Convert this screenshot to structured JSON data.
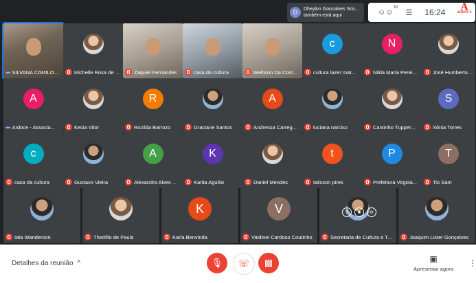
{
  "notification": {
    "text_line1": "Dheylon Goncalves Sco...",
    "text_line2": "também está aqui",
    "avatar_letter": "D"
  },
  "status": {
    "participants_count": "32",
    "time": "16:24",
    "logo_text": "A",
    "logo_sub": "ARDOCE"
  },
  "tiles_row1_video": [
    {
      "name": "SILVANA CAMILO...",
      "state": "speaking"
    },
    {
      "name": "Michelle Rosa de ...",
      "state": "muted"
    },
    {
      "name": "Zaquiel Fernandes",
      "state": "muted"
    },
    {
      "name": "casa da cultura",
      "state": "muted"
    },
    {
      "name": "Wellison Da Cost...",
      "state": "muted"
    }
  ],
  "tiles_row1_avatar": [
    {
      "letter": "c",
      "color": "#1a9be0",
      "name": "cultura lazer mat..."
    },
    {
      "letter": "N",
      "color": "#e91e63",
      "name": "Nilda Maria Perei..."
    },
    {
      "letter": "",
      "color": "photo",
      "name": "José Humberto F..."
    }
  ],
  "tiles_row2": [
    {
      "letter": "A",
      "color": "#e91e63",
      "name": "Ardoce - Associa...",
      "state": "speaking"
    },
    {
      "letter": "",
      "color": "photo",
      "name": "Kecia Vitor",
      "state": "muted"
    },
    {
      "letter": "R",
      "color": "#f57c00",
      "name": "Rozilda Barrozo",
      "state": "muted"
    },
    {
      "letter": "",
      "color": "photo2",
      "name": "Graciane Santos",
      "state": "muted"
    },
    {
      "letter": "A",
      "color": "#e64a19",
      "name": "Andressa Carreg...",
      "state": "muted"
    },
    {
      "letter": "",
      "color": "photo2",
      "name": "luciana narciso",
      "state": "muted"
    },
    {
      "letter": "",
      "color": "photo",
      "name": "Cantinho Tupper...",
      "state": "muted"
    },
    {
      "letter": "S",
      "color": "#5c6bc0",
      "name": "Sônia Torres",
      "state": "muted"
    }
  ],
  "tiles_row3": [
    {
      "letter": "c",
      "color": "#00acc1",
      "name": "casa da cultura",
      "state": "muted"
    },
    {
      "letter": "",
      "color": "photo2",
      "name": "Gustavo Vieira",
      "state": "muted"
    },
    {
      "letter": "A",
      "color": "#43a047",
      "name": "Alexandra Alves ...",
      "state": "muted"
    },
    {
      "letter": "K",
      "color": "#5e35b1",
      "name": "Karita Aguilar",
      "state": "muted"
    },
    {
      "letter": "",
      "color": "photo",
      "name": "Daniel Mendes",
      "state": "muted"
    },
    {
      "letter": "t",
      "color": "#f4511e",
      "name": "talisson pires",
      "state": "muted"
    },
    {
      "letter": "P",
      "color": "#1e88e5",
      "name": "Prefeitura Virgola...",
      "state": "muted"
    },
    {
      "letter": "T",
      "color": "#8d6e63",
      "name": "Tio Sam",
      "state": "muted"
    }
  ],
  "tiles_row4": [
    {
      "letter": "",
      "color": "photo2",
      "name": "Iata Wanderson"
    },
    {
      "letter": "",
      "color": "photo",
      "name": "Theófilo de Paula"
    },
    {
      "letter": "K",
      "color": "#e64a19",
      "name": "Karla Benvinda"
    },
    {
      "letter": "V",
      "color": "#8d6e63",
      "name": "Valdinei Cardoso Coutinho"
    },
    {
      "letter": "",
      "color": "photo2",
      "name": "Secretaria de Cultura e Tur..."
    },
    {
      "letter": "",
      "color": "photo2",
      "name": "Joaquim Lister Gonçalves"
    }
  ],
  "bottombar": {
    "meeting_details": "Detalhes da reunião",
    "chevron": "^",
    "present_label": "Apresentar agora"
  },
  "colors": {
    "accent_red": "#ea4335",
    "dark_bg": "#202124",
    "tile_bg": "#3c4043"
  }
}
